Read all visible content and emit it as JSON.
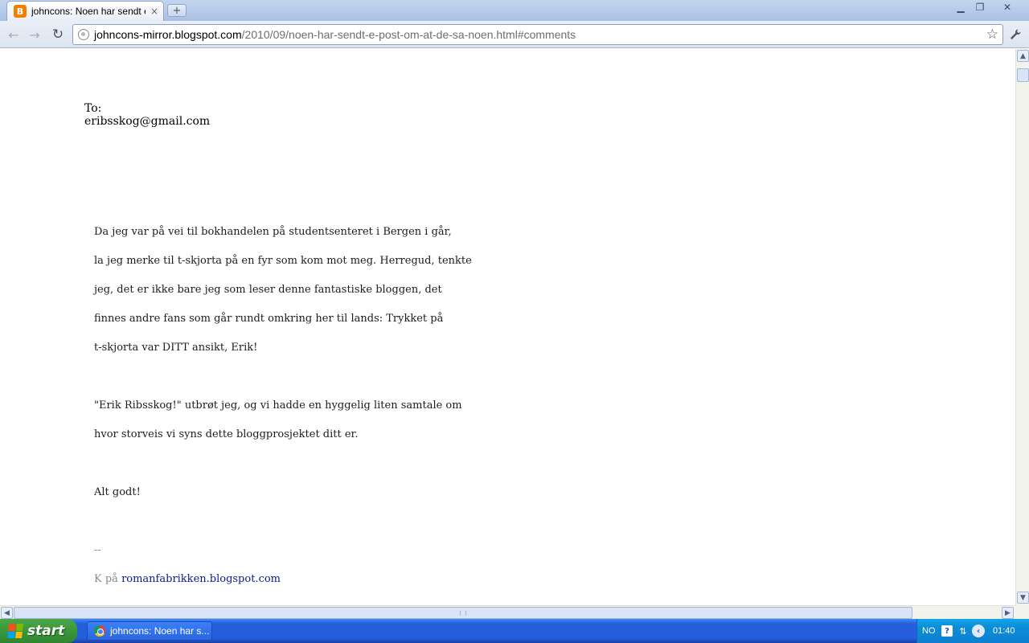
{
  "browser": {
    "tab": {
      "title": "johncons: Noen har sendt e-post om at de så noen",
      "favicon": "blogger-icon",
      "close_glyph": "×"
    },
    "new_tab_glyph": "+",
    "window_controls": {
      "minimize": "▁",
      "maximize": "❐",
      "close": "✕"
    },
    "toolbar": {
      "back": "←",
      "forward": "→",
      "reload": "↻",
      "star": "☆",
      "wrench": "🔧"
    },
    "address": {
      "host": "johncons-mirror.blogspot.com",
      "path": "/2010/09/noen-har-sendt-e-post-om-at-de-sa-noen.html#comments"
    }
  },
  "email": {
    "to_label": "To:",
    "to_address": "eribsskog@gmail.com",
    "paragraphs": [
      [
        "Da jeg var på vei til bokhandelen på studentsenteret i Bergen i går,",
        "la jeg merke til t-skjorta på en fyr som kom mot meg. Herregud, tenkte",
        "jeg, det er ikke bare jeg som leser denne fantastiske bloggen, det",
        "finnes andre fans som går rundt omkring her til lands: Trykket på",
        "t-skjorta var DITT ansikt, Erik!"
      ],
      [
        "\"Erik Ribsskog!\" utbrøt jeg, og vi hadde en hyggelig liten samtale om",
        "hvor storveis vi syns dette bloggprosjektet ditt er."
      ],
      [
        "Alt godt!"
      ]
    ],
    "signature": {
      "dashes": "--",
      "prefix": "K på ",
      "link": "romanfabrikken.blogspot.com"
    }
  },
  "scrollbars": {
    "up": "▲",
    "down": "▼",
    "left": "◀",
    "right": "▶"
  },
  "taskbar": {
    "start_label": "start",
    "task_label": "johncons: Noen har s...",
    "language": "NO",
    "help": "?",
    "network": "⇅",
    "expand": "‹",
    "clock": "01:40"
  },
  "colors": {
    "link": "#0b1a8e",
    "signature_gray": "#888888",
    "taskbar_blue": "#245edb",
    "start_green": "#3c9a3c"
  }
}
